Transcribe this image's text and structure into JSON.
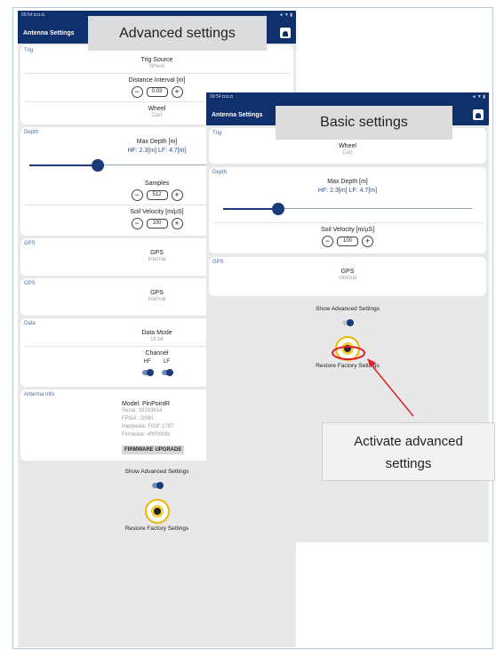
{
  "advanced": {
    "status_left": "09:54 ◘ ◘ ◘",
    "status_right": "◄ ▼ ▮",
    "app_title": "Antenna Settings",
    "banner": "Advanced settings",
    "trig": {
      "section": "Trig",
      "trig_source_label": "Trig Source",
      "trig_source_value": "Wheel",
      "distance_label": "Distance Interval [m]",
      "distance_value": "0.03",
      "wheel_label": "Wheel",
      "wheel_value": "Cart"
    },
    "depth": {
      "section": "Depth",
      "max_depth_label": "Max Depth [m]",
      "hf_lf_text": "HF: 2.3[m]   LF: 4.7[m]",
      "slider_level": 0.27,
      "samples_label": "Samples",
      "samples_value": "512",
      "soil_velocity_label": "Soil Velocity [m/µS]",
      "soil_velocity_value": "100"
    },
    "gps1": {
      "section": "GPS",
      "label": "GPS",
      "value": "Internal"
    },
    "gps2": {
      "section": "GPS",
      "label": "GPS",
      "value": "Internal"
    },
    "data": {
      "section": "Data",
      "mode_label": "Data Mode",
      "mode_value": "16 bit",
      "channel_label": "Channel",
      "hf": "HF",
      "lf": "LF"
    },
    "antenna_info": {
      "section": "Antenna Info",
      "model": "Model: PinPointR",
      "serial": "Serial: 19143614",
      "fpga": "FPGA : D090",
      "hardware": "Hardware: F00F 1707",
      "firmware": "Firmware: #000009c",
      "upgrade_button": "FIRMWARE UPGRADE"
    },
    "show_advanced": "Show Advanced Settings",
    "restore": "Restore Factory Settings"
  },
  "basic": {
    "status_left": "09:54 ◘ ◘ ◘",
    "status_right": "◄ ▼ ▮",
    "app_title": "Antenna Settings",
    "banner": "Basic settings",
    "trig": {
      "section": "Trig",
      "wheel_label": "Wheel",
      "wheel_value": "Cart"
    },
    "depth": {
      "section": "Depth",
      "max_depth_label": "Max Depth [m]",
      "hf_lf_text": "HF: 2.3[m]   LF: 4.7[m]",
      "slider_level": 0.22,
      "soil_velocity_label": "Soil Velocity [m/µS]",
      "soil_velocity_value": "100"
    },
    "gps": {
      "section": "GPS",
      "label": "GPS",
      "value": "Internal"
    },
    "show_advanced": "Show Advanced Settings",
    "restore": "Restore Factory Settings"
  },
  "callout_text": "Activate advanced settings",
  "colors": {
    "appbar": "#0f2f6d",
    "accent": "#1a3a7a",
    "highlight": "#e0202a"
  }
}
